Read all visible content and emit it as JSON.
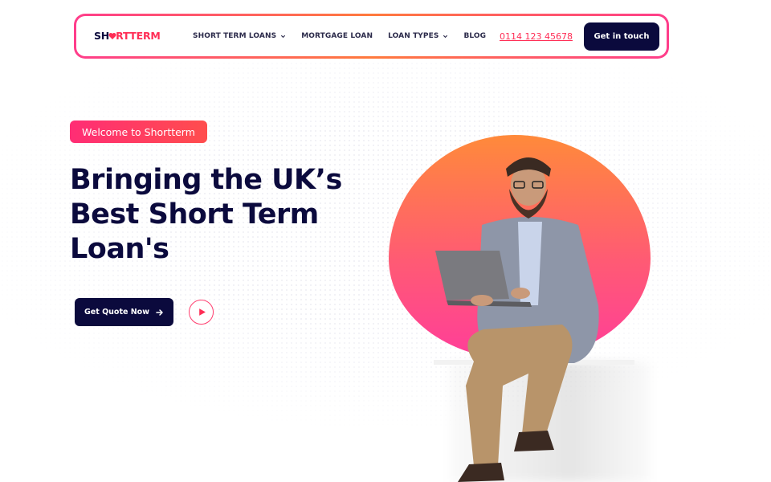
{
  "brand": {
    "name_dark": "SH",
    "name_accent": "RT",
    "name_dark2": "TERM",
    "accent_color": "#ff2d55"
  },
  "nav": {
    "items": [
      {
        "label": "SHORT TERM LOANS",
        "has_dropdown": true
      },
      {
        "label": "MORTGAGE LOAN",
        "has_dropdown": false
      },
      {
        "label": "LOAN TYPES",
        "has_dropdown": true
      },
      {
        "label": "BLOG",
        "has_dropdown": false
      }
    ],
    "phone": "0114 123 45678",
    "cta": "Get in touch"
  },
  "hero": {
    "badge": "Welcome to Shortterm",
    "headline_line1": "Bringing the UK’s",
    "headline_line2": "Best Short Term",
    "headline_line3": "Loan's",
    "quote_button": "Get Quote Now",
    "icons": {
      "quote_arrow": "arrow-right-icon",
      "play": "play-icon"
    }
  },
  "colors": {
    "navy": "#0b0a3d",
    "pink": "#ff2d75",
    "orange": "#ff8a3a"
  }
}
